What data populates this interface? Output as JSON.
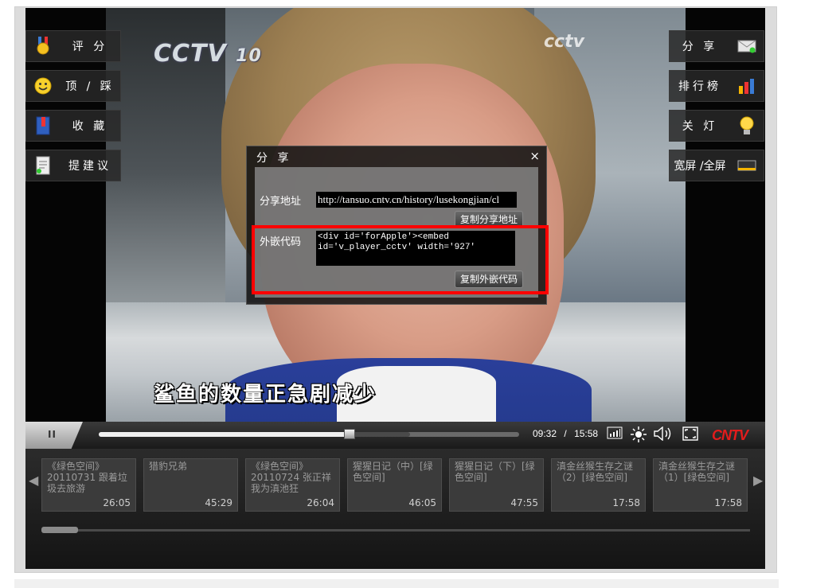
{
  "video": {
    "channel_logo": "CCTV",
    "channel_number": "10",
    "watermark": "cctv",
    "subtitle": "鲨鱼的数量正急剧减少"
  },
  "left_buttons": [
    {
      "label": "评 分",
      "icon": "medal-icon"
    },
    {
      "label": "顶 / 踩",
      "icon": "smiley-icon"
    },
    {
      "label": "收 藏",
      "icon": "bookmark-icon"
    },
    {
      "label": "提建议",
      "icon": "document-icon"
    }
  ],
  "right_buttons": [
    {
      "label": "分 享",
      "icon": "envelope-icon"
    },
    {
      "label": "排行榜",
      "icon": "bar-chart-icon"
    },
    {
      "label": "关 灯",
      "icon": "lightbulb-icon"
    },
    {
      "label": "宽屏 /全屏",
      "icon": "widescreen-icon"
    }
  ],
  "share_dialog": {
    "title": "分 享",
    "close": "×",
    "url_label": "分享地址",
    "url_value": "http://tansuo.cntv.cn/history/lusekongjian/cl",
    "copy_url_button": "复制分享地址",
    "embed_label": "外嵌代码",
    "embed_line1": "<div id='forApple'><embed",
    "embed_line2": "id='v_player_cctv' width='927'",
    "copy_embed_button": "复制外嵌代码"
  },
  "controls": {
    "pause": "II",
    "current_time": "09:32",
    "separator": "/",
    "total_time": "15:58",
    "progress_fraction": 0.596,
    "buffered_fraction": 0.74,
    "brand": "CNTV"
  },
  "playlist": [
    {
      "title": "《绿色空间》20110731 跟着垃圾去旅游",
      "duration": "26:05"
    },
    {
      "title": "猎豹兄弟",
      "duration": "45:29"
    },
    {
      "title": "《绿色空间》20110724 张正祥 我为滇池狂",
      "duration": "26:04"
    },
    {
      "title": "猩猩日记（中）[绿色空间]",
      "duration": "46:05"
    },
    {
      "title": "猩猩日记（下）[绿色空间]",
      "duration": "47:55"
    },
    {
      "title": "滇金丝猴生存之谜（2）[绿色空间]",
      "duration": "17:58"
    },
    {
      "title": "滇金丝猴生存之谜（1）[绿色空间]",
      "duration": "17:58"
    }
  ],
  "colors": {
    "highlight": "#ff0000",
    "brand_red": "#e31c1c"
  }
}
